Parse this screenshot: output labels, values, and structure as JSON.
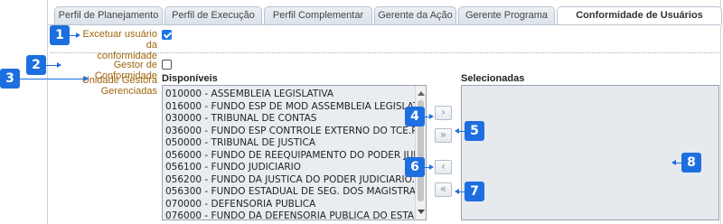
{
  "tabs": [
    {
      "label": "Perfil de Planejamento",
      "active": false
    },
    {
      "label": "Perfil de Execução",
      "active": false
    },
    {
      "label": "Perfil Complementar",
      "active": false
    },
    {
      "label": "Gerente da Ação",
      "active": false
    },
    {
      "label": "Gerente Programa",
      "active": false
    },
    {
      "label": "Conformidade de Usuários",
      "active": true
    }
  ],
  "form": {
    "exceptuar_line1": "Excetuar usuário da",
    "exceptuar_line2": "conformidade",
    "exceptuar_checked": true,
    "gestor_label": "Gestor de Conformidade",
    "gestor_checked": false,
    "unidade_line1": "Unidade Gestora",
    "unidade_line2": "Gerenciadas"
  },
  "available": {
    "title": "Disponíveis",
    "items": [
      "010000 - ASSEMBLEIA LEGISLATIVA",
      "016000 - FUNDO ESP DE MOD ASSEMBLEIA LEGISLATIVA",
      "030000 - TRIBUNAL DE CONTAS",
      "036000 - FUNDO ESP CONTROLE EXTERNO DO TCE.PR",
      "050000 - TRIBUNAL DE JUSTICA",
      "056000 - FUNDO DE REEQUIPAMENTO DO PODER JUDICIAR",
      "056100 - FUNDO JUDICIARIO",
      "056200 - FUNDO DA JUSTICA DO PODER JUDICIARIO.PR",
      "056300 - FUNDO ESTADUAL DE SEG. DOS MAGISTRADOS",
      "070000 - DEFENSORIA PUBLICA",
      "076000 - FUNDO DA DEFENSORIA PUBLICA DO ESTADO PR"
    ]
  },
  "selected": {
    "title": "Selecionadas",
    "items": []
  },
  "buttons": {
    "move_right": "›",
    "move_all_right": "»",
    "move_left": "‹",
    "move_all_left": "«"
  },
  "callouts": [
    "1",
    "2",
    "3",
    "4",
    "5",
    "6",
    "7",
    "8"
  ],
  "colors": {
    "callout": "#1d6fe0",
    "label": "#a0650d",
    "checkbox_checked": "#1a73e8"
  }
}
